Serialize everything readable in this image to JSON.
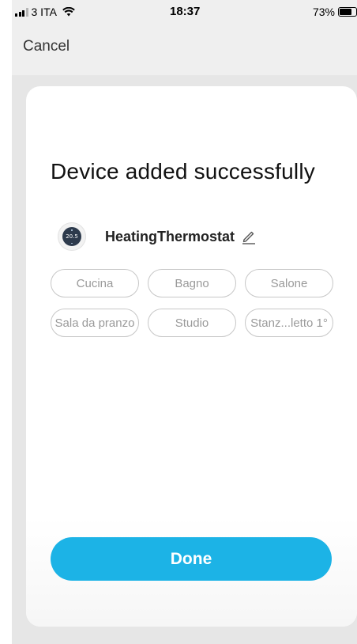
{
  "status_bar": {
    "carrier": "3 ITA",
    "time": "18:37",
    "battery_percent": "73%",
    "battery_level": 0.73
  },
  "header": {
    "cancel_label": "Cancel"
  },
  "card": {
    "title": "Device added successfully",
    "device": {
      "icon": "thermostat-icon",
      "icon_reading": "20.5",
      "name": "HeatingThermostat",
      "edit_icon": "pencil-icon"
    },
    "rooms": [
      "Cucina",
      "Bagno",
      "Salone",
      "Sala da pranzo",
      "Studio",
      "Stanz...letto 1°"
    ],
    "done_label": "Done",
    "accent_color": "#1cb3e6"
  }
}
